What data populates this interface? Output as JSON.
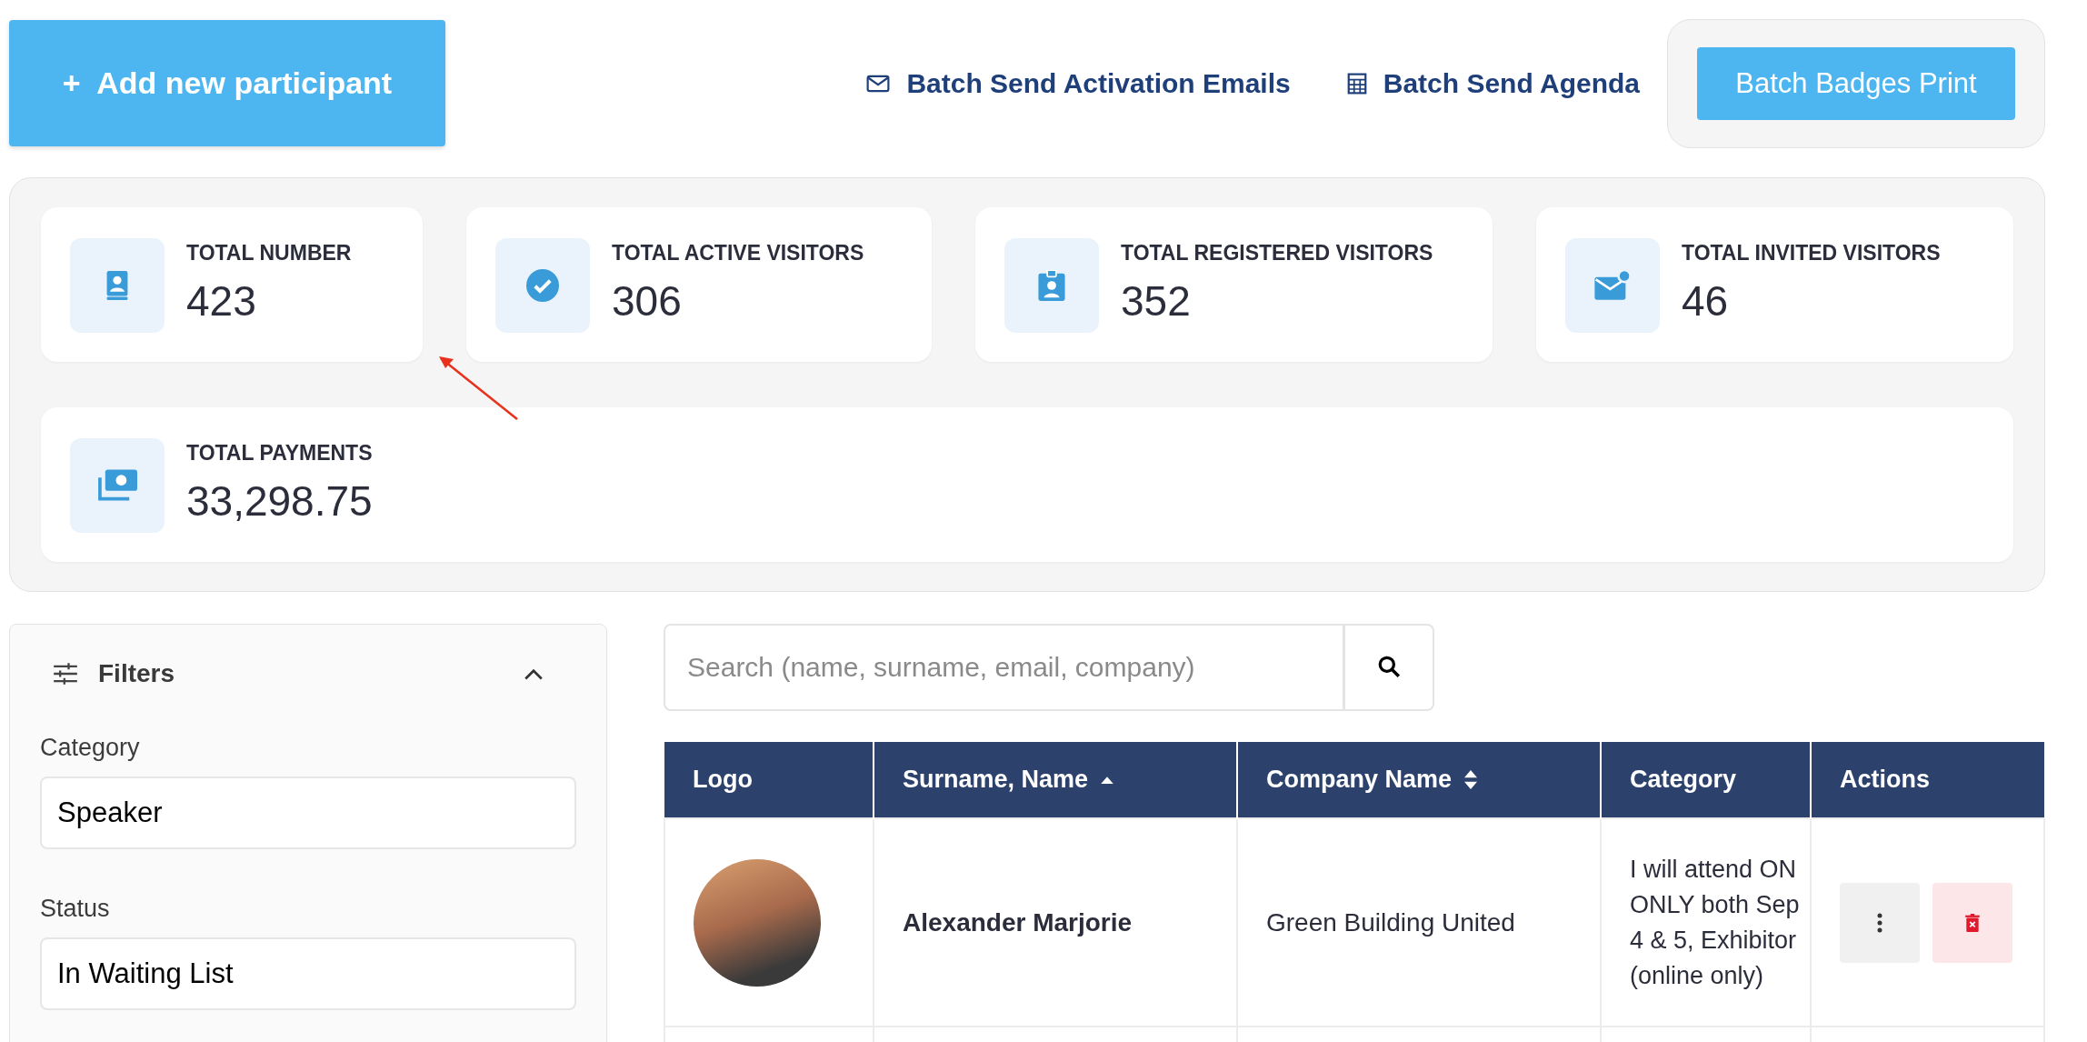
{
  "toolbar": {
    "add_button": {
      "icon": "+",
      "label": "Add new participant"
    },
    "links": [
      {
        "label": "Batch Send Activation Emails"
      },
      {
        "label": "Batch Send Agenda"
      }
    ],
    "print_button": {
      "label": "Batch Badges Print"
    }
  },
  "stats": [
    {
      "title": "TOTAL NUMBER",
      "value": "423"
    },
    {
      "title": "TOTAL ACTIVE VISITORS",
      "value": "306"
    },
    {
      "title": "TOTAL REGISTERED VISITORS",
      "value": "352"
    },
    {
      "title": "TOTAL INVITED VISITORS",
      "value": "46"
    },
    {
      "title": "TOTAL PAYMENTS",
      "value": "33,298.75"
    }
  ],
  "filters": {
    "title": "Filters",
    "expanded": true,
    "fields": [
      {
        "label": "Category",
        "value": "Speaker"
      },
      {
        "label": "Status",
        "value": "In Waiting List"
      }
    ]
  },
  "search": {
    "placeholder": "Search (name, surname, email, company)"
  },
  "table": {
    "columns": [
      {
        "label": "Logo",
        "sortable": false
      },
      {
        "label": "Surname, Name",
        "sortable": true,
        "sorted_ascending": true
      },
      {
        "label": "Company Name",
        "sortable": true,
        "sorted_ascending": false
      },
      {
        "label": "Category",
        "sortable": false
      },
      {
        "label": "Actions",
        "sortable": false
      }
    ],
    "rows": [
      {
        "name": "Alexander Marjorie",
        "company": "Green Building United",
        "category_lines": [
          "I will attend ON",
          "ONLY both Sep",
          "4 & 5, Exhibitor",
          "(online only)"
        ]
      }
    ]
  }
}
